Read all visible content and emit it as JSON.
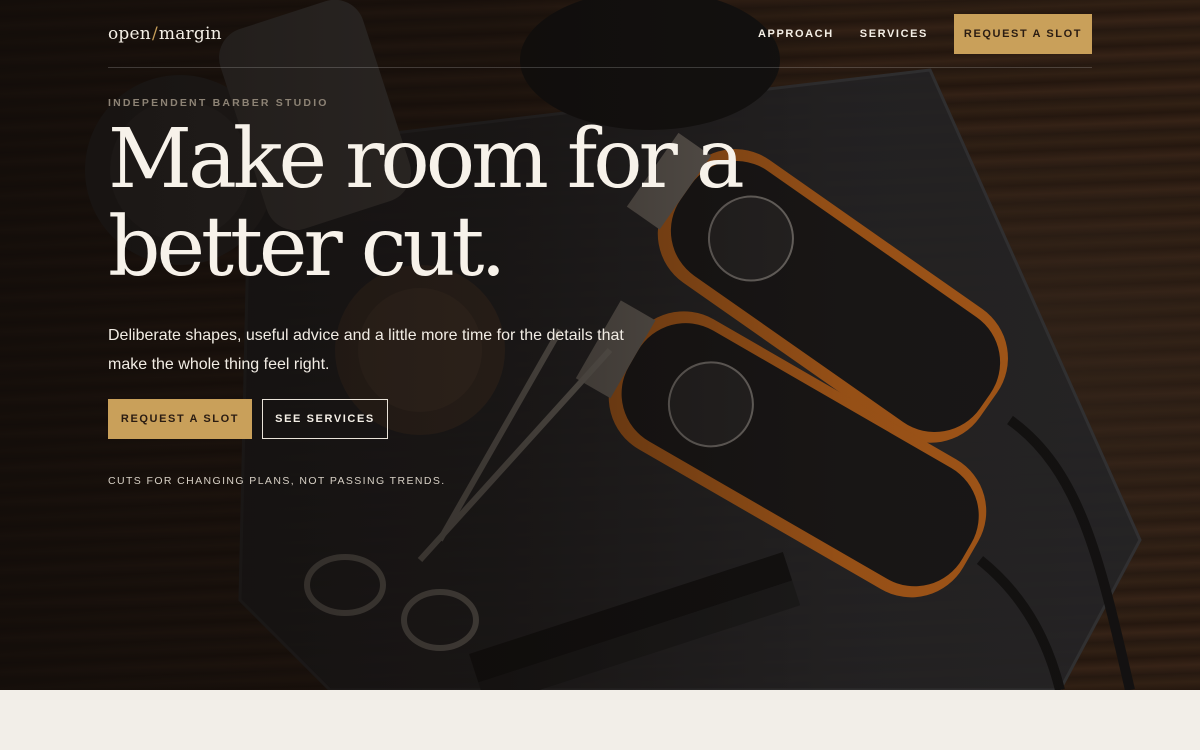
{
  "brand": {
    "logo_left": "open",
    "logo_slash": "/",
    "logo_right": "margin"
  },
  "nav": {
    "links": [
      "APPROACH",
      "SERVICES"
    ],
    "cta": "REQUEST A SLOT"
  },
  "hero": {
    "eyebrow": "INDEPENDENT BARBER STUDIO",
    "headline_line1": "Make room for a",
    "headline_line2": "better cut.",
    "lede": "Deliberate shapes, useful advice and a little more time for the details that make the whole thing feel right.",
    "primary_button": "REQUEST A SLOT",
    "secondary_button": "SEE SERVICES",
    "tagline": "CUTS FOR CHANGING PLANS, NOT PASSING TRENDS."
  },
  "colors": {
    "accent": "#c9a05a",
    "hero_text": "#f7f2ea",
    "page_background": "#f2eee8",
    "wood_dark": "#2b1d14"
  }
}
